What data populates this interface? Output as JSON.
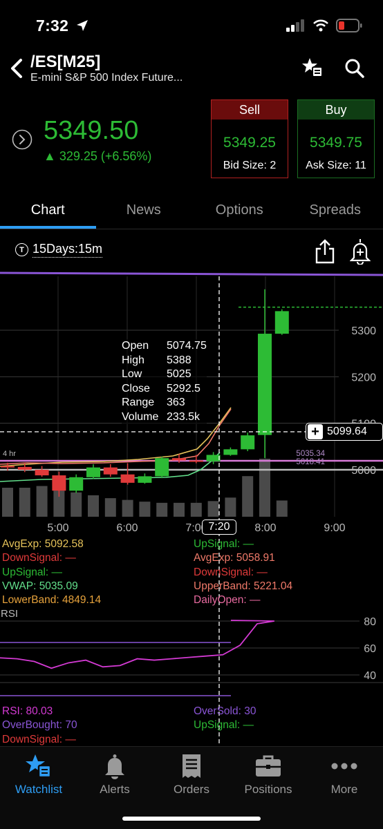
{
  "status_bar": {
    "time": "7:32"
  },
  "header": {
    "symbol": "/ES[M25]",
    "description": "E-mini S&P 500 Index Future..."
  },
  "quote": {
    "last": "5349.50",
    "change": "▲ 329.25 (+6.56%)",
    "sell_label": "Sell",
    "bid": "5349.25",
    "bid_size": "Bid Size: 2",
    "buy_label": "Buy",
    "ask": "5349.75",
    "ask_size": "Ask Size: 11"
  },
  "tabs": [
    "Chart",
    "News",
    "Options",
    "Spreads"
  ],
  "active_tab": "Chart",
  "chart_toolbar": {
    "timeframe_icon": "T",
    "timeframe": "15Days:15m"
  },
  "colors": {
    "up": "#2dbb35",
    "down": "#e03a3a",
    "accent": "#2e9df3",
    "avg_exp": "#e6c35a",
    "vwap": "#63e08c",
    "rsi": "#d43ad4",
    "upper_band": "#f07a6a"
  },
  "chart_data": {
    "type": "candlestick",
    "y_ticks": [
      "5300",
      "5200",
      "5100",
      "5000"
    ],
    "x_ticks": [
      "5:00",
      "6:00",
      "7:00",
      "7:20",
      "8:00",
      "9:00"
    ],
    "crosshair_time": "7:20",
    "crosshair_price": "5099.64",
    "price_line_labels": [
      "5035.34",
      "5018.41"
    ],
    "session_label": "4 hr",
    "tooltip": [
      {
        "label": "Open",
        "value": "5074.75"
      },
      {
        "label": "High",
        "value": "5388"
      },
      {
        "label": "Low",
        "value": "5025"
      },
      {
        "label": "Close",
        "value": "5292.5"
      },
      {
        "label": "Range",
        "value": "363"
      },
      {
        "label": "Volume",
        "value": "233.5k"
      }
    ],
    "candles": [
      {
        "o": 5008,
        "h": 5015,
        "l": 4998,
        "c": 5005
      },
      {
        "o": 5006,
        "h": 5014,
        "l": 4995,
        "c": 5000
      },
      {
        "o": 5000,
        "h": 5008,
        "l": 4985,
        "c": 4988
      },
      {
        "o": 4988,
        "h": 4996,
        "l": 4942,
        "c": 4955
      },
      {
        "o": 4955,
        "h": 4990,
        "l": 4950,
        "c": 4984
      },
      {
        "o": 4984,
        "h": 5012,
        "l": 4980,
        "c": 5005
      },
      {
        "o": 5005,
        "h": 5012,
        "l": 4985,
        "c": 4990
      },
      {
        "o": 4990,
        "h": 5014,
        "l": 4968,
        "c": 4972
      },
      {
        "o": 4972,
        "h": 4992,
        "l": 4970,
        "c": 4986
      },
      {
        "o": 4986,
        "h": 5028,
        "l": 4982,
        "c": 5025
      },
      {
        "o": 5025,
        "h": 5034,
        "l": 5015,
        "c": 5020
      },
      {
        "o": 5020,
        "h": 5032,
        "l": 5014,
        "c": 5018
      },
      {
        "o": 5018,
        "h": 5038,
        "l": 5012,
        "c": 5032
      },
      {
        "o": 5032,
        "h": 5048,
        "l": 5030,
        "c": 5044
      },
      {
        "o": 5044,
        "h": 5080,
        "l": 5040,
        "c": 5074
      },
      {
        "o": 5074.75,
        "h": 5388,
        "l": 5025,
        "c": 5292.5
      },
      {
        "o": 5292.5,
        "h": 5345,
        "l": 5290,
        "c": 5341
      }
    ],
    "volume": [
      0.5,
      0.5,
      0.53,
      0.45,
      0.42,
      0.37,
      0.32,
      0.29,
      0.26,
      0.24,
      0.24,
      0.24,
      0.27,
      0.33,
      0.7,
      1.0,
      0.28
    ],
    "rsi_values": [
      53,
      52,
      50,
      45,
      49,
      51,
      46,
      47,
      52,
      51,
      52,
      53,
      54,
      55,
      62,
      78,
      80
    ],
    "rsi_ticks": [
      "80",
      "60",
      "40"
    ],
    "last_price_line": 5349.5
  },
  "price_indicators_left": [
    {
      "label": "AvgExp:",
      "value": "5092.58",
      "color": "#e6c35a"
    },
    {
      "label": "DownSignal:",
      "value": "—",
      "color": "#e03a3a"
    },
    {
      "label": "UpSignal:",
      "value": "—",
      "color": "#2dbb35"
    },
    {
      "label": "VWAP:",
      "value": "5035.09",
      "color": "#63e08c"
    },
    {
      "label": "LowerBand:",
      "value": "4849.14",
      "color": "#e6a23c"
    }
  ],
  "price_indicators_right": [
    {
      "label": "UpSignal:",
      "value": "—",
      "color": "#2dbb35"
    },
    {
      "label": "AvgExp:",
      "value": "5058.91",
      "color": "#f07a6a"
    },
    {
      "label": "DownSignal:",
      "value": "—",
      "color": "#e03a3a"
    },
    {
      "label": "UpperBand:",
      "value": "5221.04",
      "color": "#f07a6a"
    },
    {
      "label": "DailyOpen:",
      "value": "—",
      "color": "#e86aa0"
    }
  ],
  "rsi_panel": {
    "title": "RSI",
    "left": [
      {
        "label": "RSI:",
        "value": "80.03",
        "color": "#d43ad4"
      },
      {
        "label": "OverBought:",
        "value": "70",
        "color": "#8a55d6"
      },
      {
        "label": "DownSignal:",
        "value": "—",
        "color": "#e03a3a"
      }
    ],
    "right": [
      {
        "label": "OverSold:",
        "value": "30",
        "color": "#8a55d6"
      },
      {
        "label": "UpSignal:",
        "value": "—",
        "color": "#2dbb35"
      }
    ]
  },
  "tab_bar": [
    {
      "label": "Watchlist",
      "icon": "watchlist-star-icon",
      "active": true
    },
    {
      "label": "Alerts",
      "icon": "bell-icon",
      "active": false
    },
    {
      "label": "Orders",
      "icon": "receipt-icon",
      "active": false
    },
    {
      "label": "Positions",
      "icon": "briefcase-icon",
      "active": false
    },
    {
      "label": "More",
      "icon": "ellipsis-icon",
      "active": false
    }
  ]
}
